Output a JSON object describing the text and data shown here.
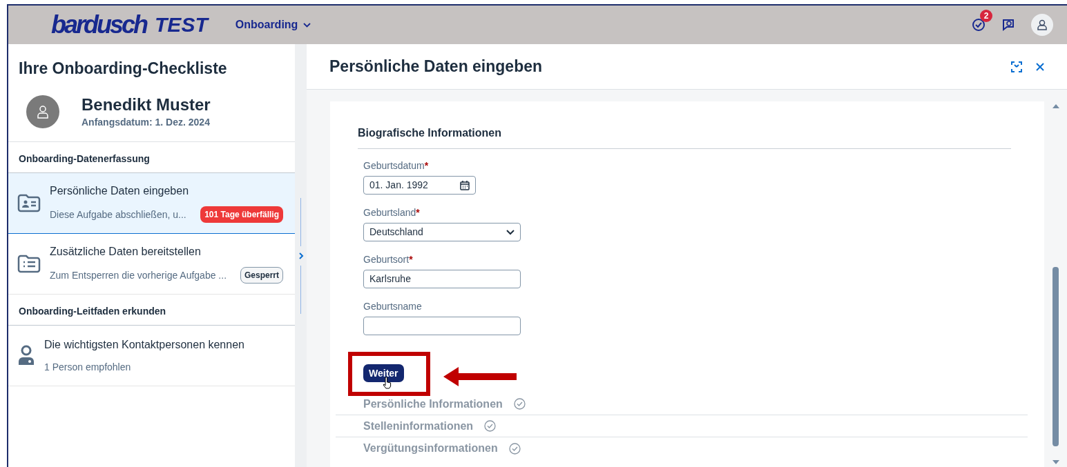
{
  "header": {
    "logo": "bardusch",
    "logo_suffix": "TEST",
    "menu": "Onboarding",
    "notification_count": "2"
  },
  "sidebar": {
    "title": "Ihre Onboarding-Checkliste",
    "person": {
      "name": "Benedikt Muster",
      "start_date": "Anfangsdatum: 1. Dez. 2024"
    },
    "groups": [
      {
        "title": "Onboarding-Datenerfassung",
        "items": [
          {
            "kind": "card",
            "title": "Persönliche Daten eingeben",
            "subtitle": "Diese Aufgabe abschließen, u...",
            "badge": {
              "kind": "overdue",
              "text": "101 Tage überfällig"
            },
            "selected": true
          },
          {
            "kind": "list",
            "title": "Zusätzliche Daten bereitstellen",
            "subtitle": "Zum Entsperren die vorherige Aufgabe ...",
            "badge": {
              "kind": "locked",
              "text": "Gesperrt"
            },
            "selected": false
          }
        ]
      },
      {
        "title": "Onboarding-Leitfaden erkunden",
        "items": [
          {
            "kind": "person",
            "title": "Die wichtigsten Kontaktpersonen kennen",
            "subtitle": "1 Person empfohlen",
            "selected": false
          }
        ]
      }
    ]
  },
  "detail": {
    "title": "Persönliche Daten eingeben",
    "section_title": "Biografische Informationen",
    "fields": [
      {
        "kind": "date",
        "label": "Geburtsdatum",
        "required_mark": "*",
        "value": "01. Jan. 1992"
      },
      {
        "kind": "select",
        "label": "Geburtsland",
        "required_mark": "*",
        "value": "Deutschland"
      },
      {
        "kind": "text",
        "label": "Geburtsort",
        "required_mark": "*",
        "value": "Karlsruhe"
      },
      {
        "kind": "text",
        "label": "Geburtsname"
      }
    ],
    "next_button": "Weiter",
    "steps": [
      "Persönliche Informationen",
      "Stelleninformationen",
      "Vergütungsinformationen"
    ]
  }
}
